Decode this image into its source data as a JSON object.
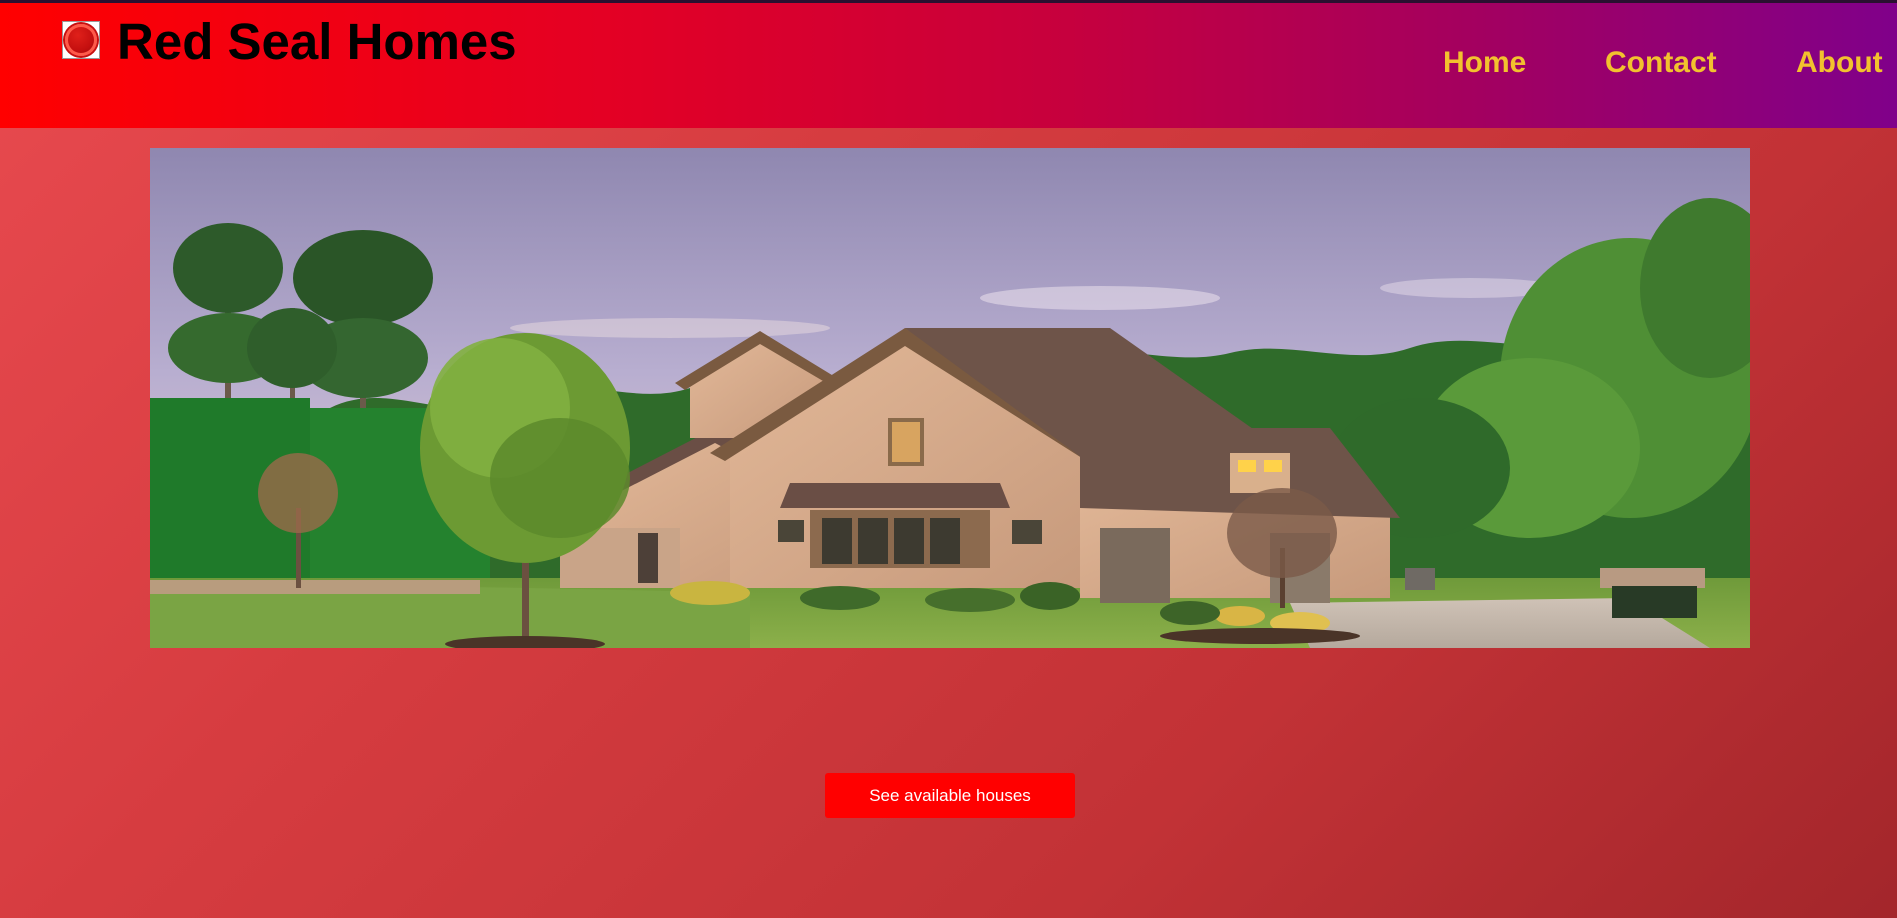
{
  "brand": {
    "name": "Red Seal Homes",
    "logo_icon": "red-seal-icon"
  },
  "nav": {
    "items": [
      {
        "label": "Home"
      },
      {
        "label": "Contact"
      },
      {
        "label": "About"
      }
    ]
  },
  "hero": {
    "image_subject": "house-photo"
  },
  "cta": {
    "label": "See available houses"
  },
  "colors": {
    "header_start": "#ff0000",
    "header_end": "#80008a",
    "nav_text": "#f2c12e",
    "brand_text": "#000000",
    "button_bg": "#ff0000",
    "button_text": "#ffffff",
    "page_bg": "#d63c40"
  }
}
